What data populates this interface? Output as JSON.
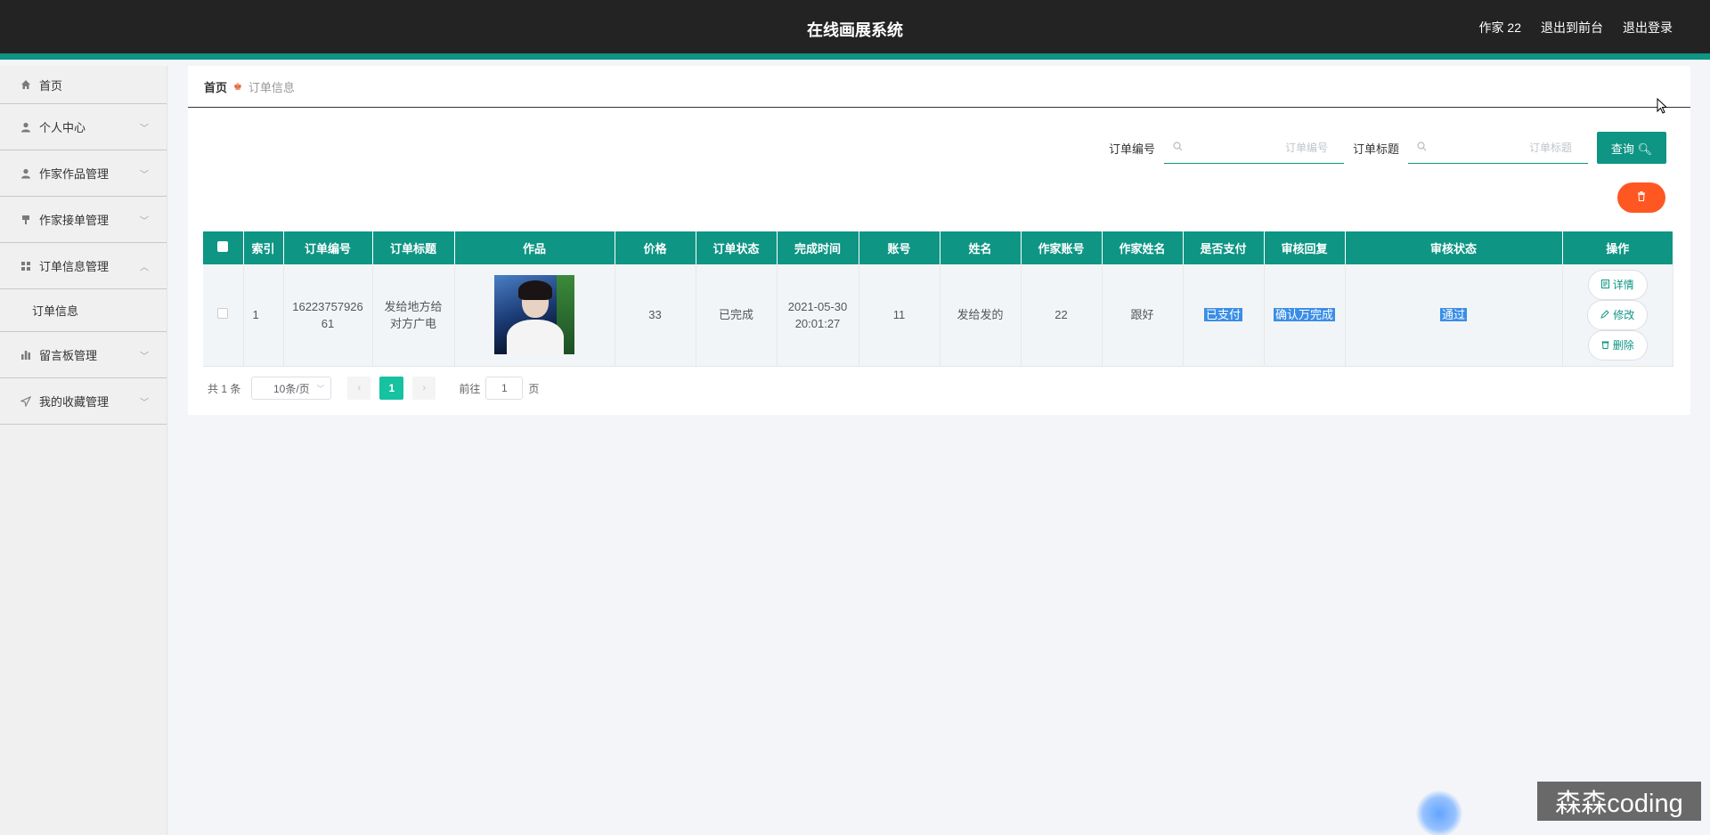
{
  "header": {
    "title": "在线画展系统",
    "user": "作家 22",
    "to_front": "退出到前台",
    "logout": "退出登录"
  },
  "sidebar": {
    "items": [
      {
        "label": "首页",
        "icon": "home-icon"
      },
      {
        "label": "个人中心",
        "icon": "user-icon"
      },
      {
        "label": "作家作品管理",
        "icon": "user-icon"
      },
      {
        "label": "作家接单管理",
        "icon": "pin-icon"
      },
      {
        "label": "订单信息管理",
        "icon": "grid-icon"
      },
      {
        "label": "留言板管理",
        "icon": "bar-chart-icon"
      },
      {
        "label": "我的收藏管理",
        "icon": "send-icon"
      }
    ],
    "submenu": "订单信息"
  },
  "breadcrumb": {
    "home": "首页",
    "current": "订单信息"
  },
  "search": {
    "order_no_label": "订单编号",
    "order_no_placeholder": "订单编号",
    "order_title_label": "订单标题",
    "order_title_placeholder": "订单标题",
    "query_button": "查询"
  },
  "table": {
    "headers": [
      "索引",
      "订单编号",
      "订单标题",
      "作品",
      "价格",
      "订单状态",
      "完成时间",
      "账号",
      "姓名",
      "作家账号",
      "作家姓名",
      "是否支付",
      "审核回复",
      "审核状态",
      "操作"
    ],
    "rows": [
      {
        "index": "1",
        "order_no": "1622375792661",
        "order_title": "发给地方给对方广电",
        "price": "33",
        "status": "已完成",
        "finish_date": "2021-05-30",
        "finish_time": "20:01:27",
        "account": "11",
        "name": "发给发的",
        "writer_account": "22",
        "writer_name": "跟好",
        "paid": "已支付",
        "review_reply": "确认万完成",
        "review_status": "通过"
      }
    ],
    "actions": {
      "detail": "详情",
      "edit": "修改",
      "delete": "删除"
    }
  },
  "pagination": {
    "total": "共 1 条",
    "page_size": "10条/页",
    "current_page": "1",
    "goto_label": "前往",
    "goto_value": "1",
    "page_suffix": "页"
  },
  "watermark": "森森coding",
  "colors": {
    "primary": "#0e9584",
    "topbar": "#232323",
    "danger": "#ff5722",
    "highlight": "#3a8ee6"
  }
}
